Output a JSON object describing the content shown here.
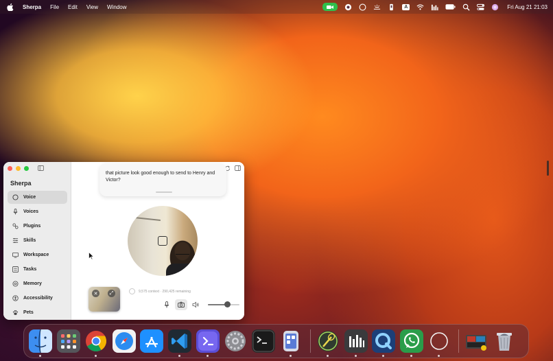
{
  "menubar": {
    "app_name": "Sherpa",
    "menus": [
      "File",
      "Edit",
      "View",
      "Window"
    ],
    "status_icons": [
      "facetime-camera-icon",
      "record-icon",
      "compass-icon",
      "brightness-icon",
      "battery-app-icon",
      "keyboard-input-icon",
      "wifi-icon",
      "stats-icon",
      "battery-icon",
      "spotlight-search-icon",
      "control-center-icon",
      "siri-icon"
    ],
    "keyboard_input_label": "A",
    "clock": "Fri Aug 21  21:03"
  },
  "window": {
    "title": "Sherpa",
    "sidebar": {
      "items": [
        {
          "label": "Voice",
          "icon": "circle-icon",
          "active": true
        },
        {
          "label": "Voices",
          "icon": "microphone-icon",
          "active": false
        },
        {
          "label": "Plugins",
          "icon": "plugins-icon",
          "active": false
        },
        {
          "label": "Skills",
          "icon": "skills-icon",
          "active": false
        },
        {
          "label": "Workspace",
          "icon": "workspace-icon",
          "active": false
        },
        {
          "label": "Tasks",
          "icon": "tasks-icon",
          "active": false
        },
        {
          "label": "Memory",
          "icon": "memory-icon",
          "active": false
        },
        {
          "label": "Accessibility",
          "icon": "accessibility-icon",
          "active": false
        },
        {
          "label": "Pets",
          "icon": "paw-icon",
          "active": false
        }
      ]
    },
    "main": {
      "message": "that picture look good enough to send to Henry and Victor?",
      "context_status": "9,575 context · 290,425 remaining",
      "volume_level": 0.65
    }
  },
  "dock": {
    "apps": [
      {
        "name": "Finder",
        "running": true
      },
      {
        "name": "Launchpad",
        "running": false
      },
      {
        "name": "Google Chrome",
        "running": true
      },
      {
        "name": "Safari",
        "running": false
      },
      {
        "name": "App Store",
        "running": false
      },
      {
        "name": "Visual Studio Code",
        "running": true
      },
      {
        "name": "Sherpa",
        "running": true
      },
      {
        "name": "System Settings",
        "running": false
      },
      {
        "name": "Terminal",
        "running": false
      },
      {
        "name": "Simulator",
        "running": true
      }
    ],
    "apps_right": [
      {
        "name": "Badminton Timer",
        "running": true
      },
      {
        "name": "Stats",
        "running": true
      },
      {
        "name": "QuickTime",
        "running": true
      },
      {
        "name": "WhatsApp",
        "running": true
      },
      {
        "name": "Circle App",
        "running": true
      }
    ],
    "stacks": [
      {
        "name": "Recent Documents"
      },
      {
        "name": "Trash"
      }
    ]
  },
  "colors": {
    "accent_green": "#2fbf4b",
    "sidebar_bg": "#ececec",
    "active_item_bg": "#d9d9d9"
  }
}
